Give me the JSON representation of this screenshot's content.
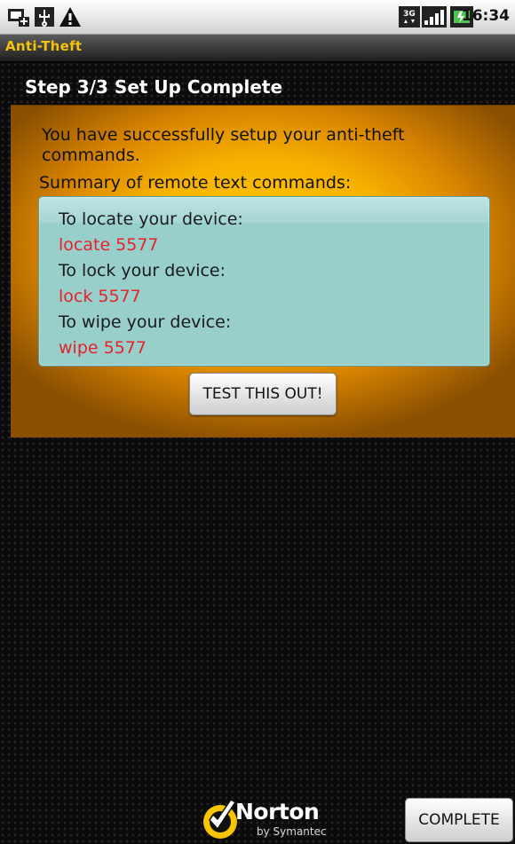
{
  "status_bar": {
    "left_icons": [
      "screen-capture-icon",
      "usb-icon",
      "warning-icon"
    ],
    "right_icons": [
      "3g-icon",
      "signal-icon",
      "battery-icon"
    ],
    "time": "16:34"
  },
  "app": {
    "title": "Anti-Theft"
  },
  "step": {
    "title": "Step 3/3 Set Up Complete"
  },
  "content": {
    "intro": "You have successfully setup your anti-theft commands.",
    "summary_label": "Summary of remote text commands:",
    "commands": [
      {
        "label": "To locate your device:",
        "command": "locate 5577"
      },
      {
        "label": "To lock your device:",
        "command": "lock 5577"
      },
      {
        "label": "To wipe your device:",
        "command": "wipe 5577"
      }
    ],
    "test_button": "TEST THIS OUT!"
  },
  "footer": {
    "brand": "Norton",
    "brand_sub": "by Symantec",
    "complete_button": "COMPLETE"
  },
  "colors": {
    "title_accent": "#f4c20a",
    "panel_orange": "#f7b200",
    "command_box": "#98cfcb",
    "command_text": "#e4232a"
  }
}
